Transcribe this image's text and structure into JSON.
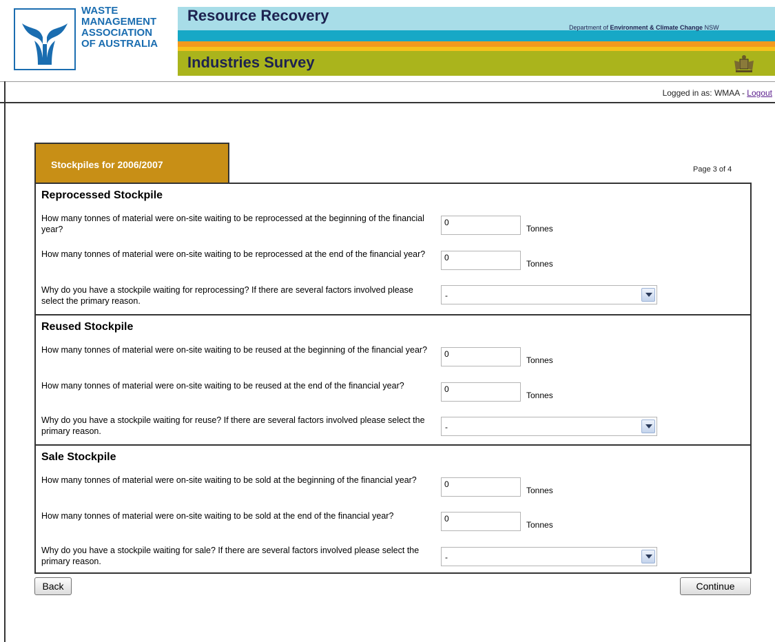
{
  "header": {
    "logo_lines": [
      "WASTE",
      "MANAGEMENT",
      "ASSOCIATION",
      "OF AUSTRALIA"
    ],
    "title_top": "Resource Recovery",
    "title_bottom": "Industries Survey",
    "dept_prefix": "Department of ",
    "dept_bold": "Environment & Climate Change",
    "dept_suffix": " NSW"
  },
  "login": {
    "text": "Logged in as: WMAA - ",
    "logout_label": "Logout"
  },
  "form": {
    "tab_title": "Stockpiles for 2006/2007",
    "page_indicator": "Page 3 of 4",
    "sections": [
      {
        "title": "Reprocessed Stockpile",
        "q1": "How many tonnes of material were on-site waiting to be reprocessed at the beginning of the financial year?",
        "q1_value": "0",
        "q2": "How many tonnes of material were on-site waiting to be reprocessed at the end of the financial year?",
        "q2_value": "0",
        "q3": "Why do you have a stockpile waiting for reprocessing? If there are several factors involved please select the primary reason.",
        "q3_value": "-"
      },
      {
        "title": "Reused Stockpile",
        "q1": "How many tonnes of material were on-site waiting to be reused at the beginning of the financial year?",
        "q1_value": "0",
        "q2": "How many tonnes of material were on-site waiting to be reused at the end of the financial year?",
        "q2_value": "0",
        "q3": "Why do you have a stockpile waiting for reuse? If there are several factors involved please select the primary reason.",
        "q3_value": "-"
      },
      {
        "title": "Sale Stockpile",
        "q1": "How many tonnes of material were on-site waiting to be sold at the beginning of the financial year?",
        "q1_value": "0",
        "q2": "How many tonnes of material were on-site waiting to be sold at the end of the financial year?",
        "q2_value": "0",
        "q3": "Why do you have a stockpile waiting for sale? If there are several factors involved please select the primary reason.",
        "q3_value": "-"
      }
    ],
    "unit_label": "Tonnes"
  },
  "buttons": {
    "back": "Back",
    "continue": "Continue"
  },
  "colors": {
    "tab_bg": "#c88f16",
    "title_text": "#1d2250",
    "logo_blue": "#1a6db0"
  }
}
